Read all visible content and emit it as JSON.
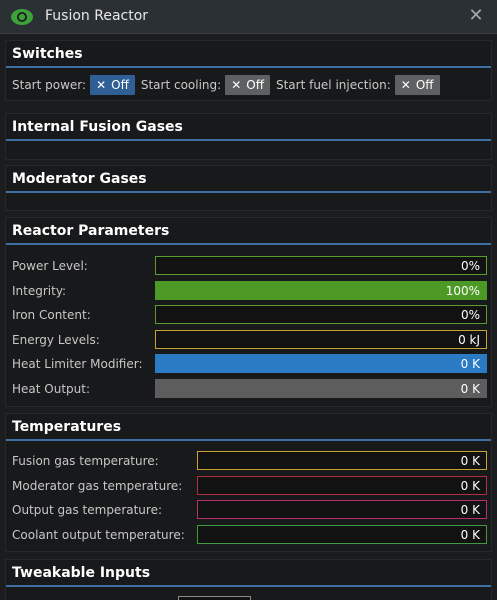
{
  "window": {
    "title": "Fusion Reactor",
    "icon": "eye-icon",
    "close_icon": "close-icon"
  },
  "sections": {
    "switches": {
      "title": "Switches",
      "items": [
        {
          "label": "Start power:",
          "state": "Off"
        },
        {
          "label": "Start cooling:",
          "state": "Off"
        },
        {
          "label": "Start fuel injection:",
          "state": "Off"
        }
      ]
    },
    "internal_gases": {
      "title": "Internal Fusion Gases"
    },
    "moderator_gases": {
      "title": "Moderator Gases"
    },
    "reactor_parameters": {
      "title": "Reactor Parameters",
      "rows": [
        {
          "label": "Power Level:",
          "value": "0%",
          "fill_fraction": 0,
          "color": "#5a9d2e"
        },
        {
          "label": "Integrity:",
          "value": "100%",
          "fill_fraction": 1,
          "color": "#4c9a25"
        },
        {
          "label": "Iron Content:",
          "value": "0%",
          "fill_fraction": 0,
          "color": "#5a9d2e"
        },
        {
          "label": "Energy Levels:",
          "value": "0 kJ",
          "fill_fraction": 0,
          "color": "#c9a233"
        },
        {
          "label": "Heat Limiter Modifier:",
          "value": "0 K",
          "fill_fraction": 1,
          "color": "#2b7bc4"
        },
        {
          "label": "Heat Output:",
          "value": "0 K",
          "fill_fraction": 1,
          "color": "#5d5d5d"
        }
      ]
    },
    "temperatures": {
      "title": "Temperatures",
      "rows": [
        {
          "label": "Fusion gas temperature:",
          "value": "0 K",
          "color": "#c9a233"
        },
        {
          "label": "Moderator gas temperature:",
          "value": "0 K",
          "color": "#b03042"
        },
        {
          "label": "Output gas temperature:",
          "value": "0 K",
          "color": "#b8306a"
        },
        {
          "label": "Coolant output temperature:",
          "value": "0 K",
          "color": "#3e9a3a"
        }
      ]
    },
    "tweakable_inputs": {
      "title": "Tweakable Inputs"
    }
  }
}
